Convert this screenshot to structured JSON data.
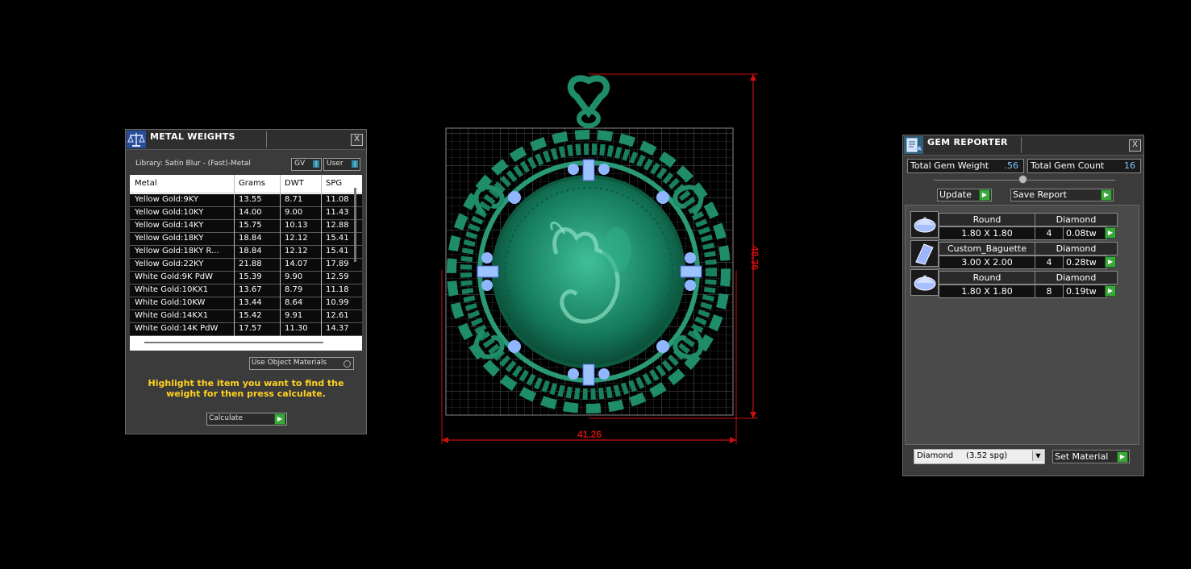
{
  "metal_weights": {
    "title": "METAL WEIGHTS",
    "close": "X",
    "library_label": "Library: Satin Blur - (Fast)-Metal",
    "gv_label": "GV",
    "user_label": "User",
    "columns": [
      "Metal",
      "Grams",
      "DWT",
      "SPG"
    ],
    "rows": [
      {
        "metal": "Yellow Gold:9KY",
        "grams": "13.55",
        "dwt": "8.71",
        "spg": "11.08"
      },
      {
        "metal": "Yellow Gold:10KY",
        "grams": "14.00",
        "dwt": "9.00",
        "spg": "11.43"
      },
      {
        "metal": "Yellow Gold:14KY",
        "grams": "15.75",
        "dwt": "10.13",
        "spg": "12.88"
      },
      {
        "metal": "Yellow Gold:18KY",
        "grams": "18.84",
        "dwt": "12.12",
        "spg": "15.41"
      },
      {
        "metal": "Yellow Gold:18KY R...",
        "grams": "18.84",
        "dwt": "12.12",
        "spg": "15.41"
      },
      {
        "metal": "Yellow Gold:22KY",
        "grams": "21.88",
        "dwt": "14.07",
        "spg": "17.89"
      },
      {
        "metal": "White Gold:9K PdW",
        "grams": "15.39",
        "dwt": "9.90",
        "spg": "12.59"
      },
      {
        "metal": "White Gold:10KX1",
        "grams": "13.67",
        "dwt": "8.79",
        "spg": "11.18"
      },
      {
        "metal": "White Gold:10KW",
        "grams": "13.44",
        "dwt": "8.64",
        "spg": "10.99"
      },
      {
        "metal": "White Gold:14KX1",
        "grams": "15.42",
        "dwt": "9.91",
        "spg": "12.61"
      },
      {
        "metal": "White Gold:14K PdW",
        "grams": "17.57",
        "dwt": "11.30",
        "spg": "14.37"
      }
    ],
    "use_object_materials": "Use Object Materials",
    "hint": "Highlight the item you want to find the weight for then press calculate.",
    "calculate_label": "Calculate"
  },
  "viewport": {
    "height_dim": "48.36",
    "width_dim": "41.26"
  },
  "gem_reporter": {
    "title": "GEM REPORTER",
    "close": "X",
    "total_weight_label": "Total Gem Weight",
    "total_weight_value": ".56",
    "total_count_label": "Total Gem Count",
    "total_count_value": "16",
    "update_label": "Update",
    "save_report_label": "Save Report",
    "gems": [
      {
        "shape": "Round",
        "material": "Diamond",
        "size": "1.80 X 1.80",
        "count": "4",
        "weight": "0.08tw"
      },
      {
        "shape": "Custom_Baguette",
        "material": "Diamond",
        "size": "3.00 X 2.00",
        "count": "4",
        "weight": "0.28tw"
      },
      {
        "shape": "Round",
        "material": "Diamond",
        "size": "1.80 X 1.80",
        "count": "8",
        "weight": "0.19tw"
      }
    ],
    "material_select": "Diamond     (3.52 spg)",
    "set_material_label": "Set Material"
  },
  "colors": {
    "background": "#000000",
    "panel": "#3b3b3b",
    "metal_model": "#1f8c6a",
    "gem_blue": "#8fb6ff",
    "dimension_red": "#cc1010",
    "hint_yellow": "#ffd21f",
    "value_blue": "#7fc6ff"
  }
}
